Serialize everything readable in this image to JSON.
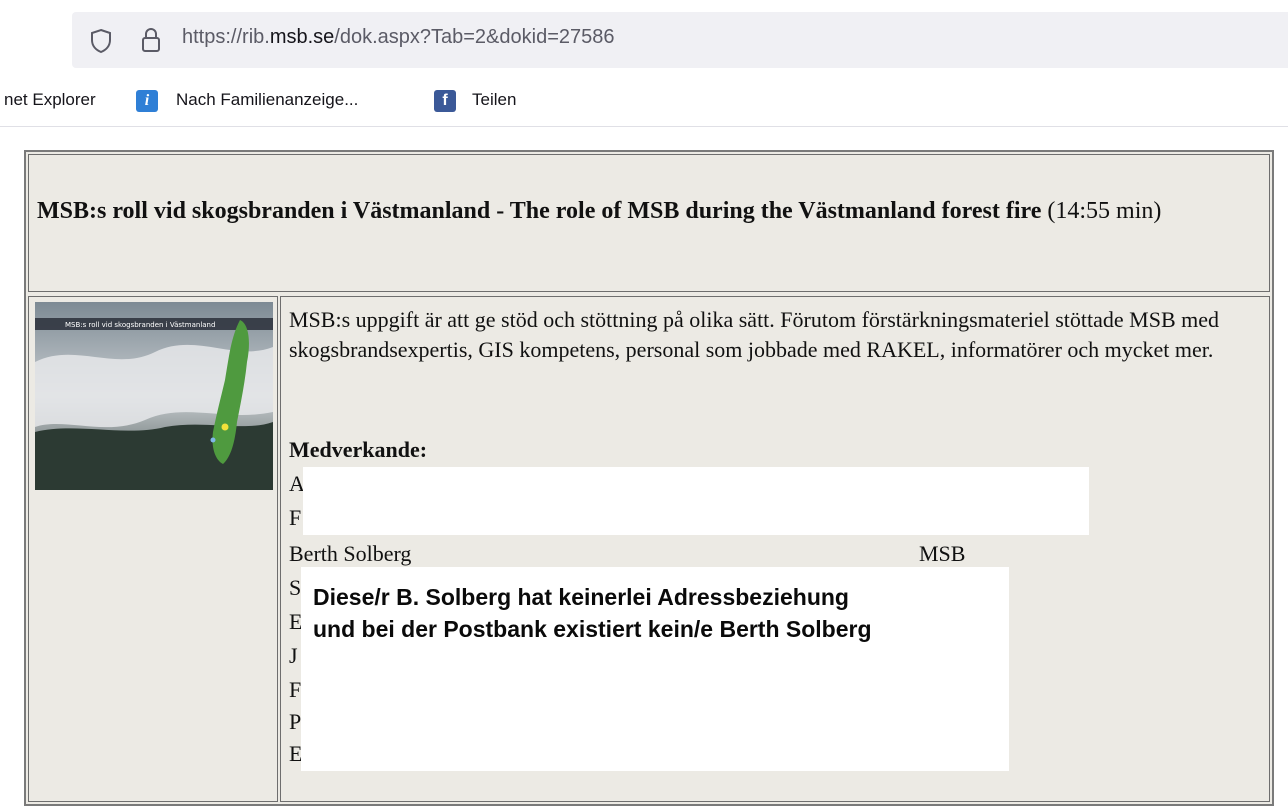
{
  "browser": {
    "url_prefix": "https://rib.",
    "url_domain": "msb.se",
    "url_path": "/dok.aspx?Tab=2&dokid=27586",
    "bookmarks": [
      {
        "label": "net Explorer"
      },
      {
        "label": "Nach Familienanzeige...",
        "icon": "info-icon"
      },
      {
        "label": "Teilen",
        "icon": "facebook-icon"
      }
    ]
  },
  "page": {
    "title_bold": "MSB:s roll vid skogsbranden i Västmanland - The role of MSB during the Västmanland forest fire",
    "duration": "(14:55 min)",
    "description": "MSB:s uppgift är att ge stöd och stöttning på olika sätt. Förutom förstärkningsmateriel stöttade MSB med skogsbrandsexpertis, GIS kompetens, personal som jobbade med RAKEL, informatörer och mycket mer.",
    "contributors_heading": "Medverkande:",
    "visible_initials": [
      "A",
      "F",
      "S",
      "E",
      "J",
      "F",
      "P",
      "E"
    ],
    "contributor_name": "Berth Solberg",
    "contributor_org": "MSB",
    "thumbnail_caption": "MSB:s roll vid skogsbranden i Västmanland"
  },
  "overlay": {
    "line1": "Diese/r B. Solberg hat keinerlei Adressbeziehung",
    "line2": "und bei der Postbank existiert kein/e Berth Solberg"
  },
  "colors": {
    "page_bg": "#eceae4",
    "map_green": "#4f9a3f"
  }
}
